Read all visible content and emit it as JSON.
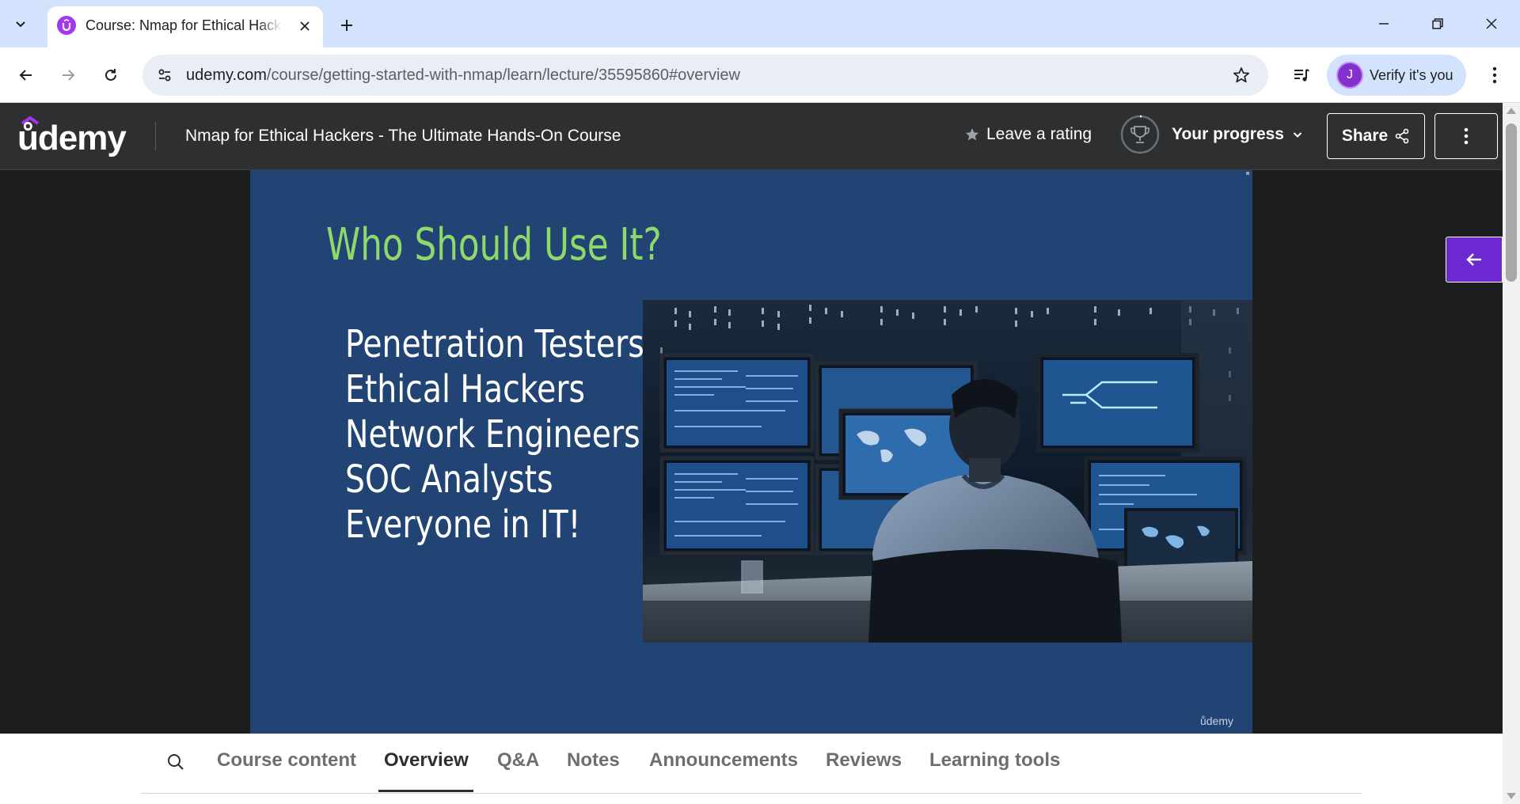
{
  "browser": {
    "tab": {
      "title": "Course: Nmap for Ethical Hackers - The Ultimate Hands-On Course",
      "favicon": "udemy-icon"
    },
    "url": {
      "host": "udemy.com",
      "path": "/course/getting-started-with-nmap/learn/lecture/35595860#overview"
    },
    "profile": {
      "initial": "J",
      "label": "Verify it's you"
    },
    "icons": {
      "tab_list": "chevron-down-icon",
      "close": "close-icon",
      "new_tab": "plus-icon",
      "minimize": "minimize-icon",
      "restore": "restore-icon",
      "window_close": "close-icon",
      "back": "back-arrow-icon",
      "forward": "forward-arrow-icon",
      "reload": "reload-icon",
      "site_info": "tune-icon",
      "bookmark": "star-icon",
      "media": "media-queue-icon",
      "menu": "kebab-menu-icon"
    }
  },
  "header": {
    "logo": "udemy",
    "course_title": "Nmap for Ethical Hackers - The Ultimate Hands-On Course",
    "rating_label": "Leave a rating",
    "progress_label": "Your progress",
    "share_label": "Share"
  },
  "slide": {
    "title": "Who Should Use It?",
    "audience": [
      "Penetration Testers",
      "Ethical Hackers",
      "Network Engineers",
      "SOC Analysts",
      "Everyone in IT!"
    ],
    "watermark": "ůdemy"
  },
  "tabs": {
    "items": [
      "Course content",
      "Overview",
      "Q&A",
      "Notes",
      "Announcements",
      "Reviews",
      "Learning tools"
    ],
    "active": "Overview"
  },
  "colors": {
    "brand_purple": "#a435f0",
    "header_bg": "#2d2f31",
    "slide_bg": "#214475",
    "slide_title": "#8fd96b",
    "sidebar_toggle": "#6d28d2",
    "chrome_tabbar": "#d3e3fd"
  }
}
